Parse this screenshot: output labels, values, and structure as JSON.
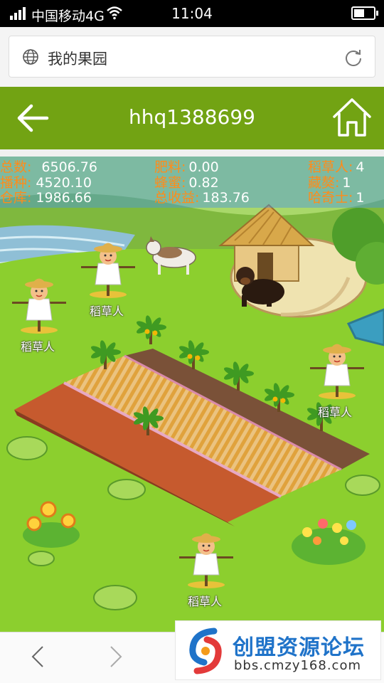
{
  "status_bar": {
    "carrier": "中国移动4G",
    "time": "11:04",
    "battery_level": 0.55
  },
  "browser": {
    "page_title": "我的果园",
    "globe_icon": "globe-icon",
    "reload_icon": "reload-icon"
  },
  "header": {
    "username": "hhq1388699",
    "back_icon": "back-arrow-icon",
    "home_icon": "home-icon"
  },
  "stats": {
    "total_label": "总数:",
    "total_value": "6506.76",
    "seed_label": "播种:",
    "seed_value": "4520.10",
    "storage_label": "仓库:",
    "storage_value": "1986.66",
    "fertilizer_label": "肥料:",
    "fertilizer_value": "0.00",
    "honey_label": "蜂蜜:",
    "honey_value": "0.82",
    "income_label": "总收益:",
    "income_value": "183.76",
    "scarecrow_label": "稻草人:",
    "scarecrow_value": "4",
    "mastiff_label": "藏獒:",
    "mastiff_value": "1",
    "husky_label": "哈奇士:",
    "husky_value": "1"
  },
  "scarecrows": {
    "label_1": "稻草人",
    "label_2": "稻草人",
    "label_3": "稻草人",
    "label_4": "稻草人"
  },
  "bottom_nav": {
    "prev_icon": "chevron-left-icon",
    "next_icon": "chevron-right-icon"
  },
  "watermark": {
    "brand": "创盟资源论坛",
    "url": "bbs.cmzy168.com"
  },
  "colors": {
    "header_green": "#72a313",
    "stat_key": "#ff8c1a",
    "grass": "#8ccf2e",
    "brand_blue": "#1f73c9"
  }
}
